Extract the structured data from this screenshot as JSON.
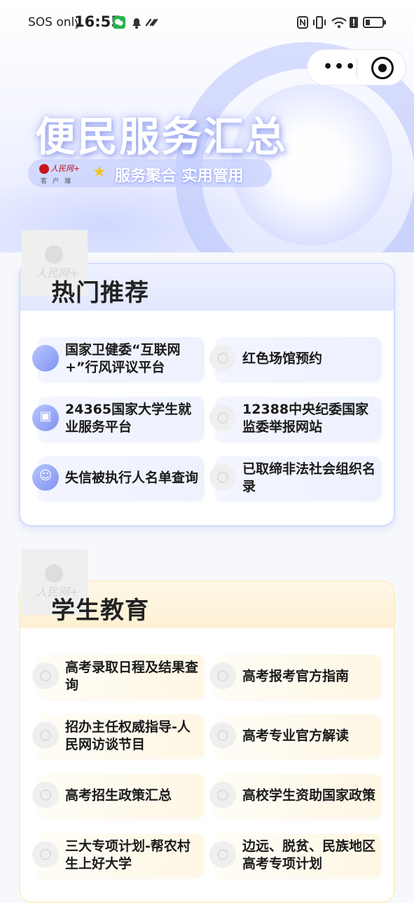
{
  "status_bar": {
    "carrier": "SOS only",
    "time": "16:55"
  },
  "header": {
    "title": "便民服务汇总",
    "logo_brand": "人民网+",
    "logo_sub": "客户端",
    "tagline": "服务聚合 实用管用"
  },
  "capsule": {
    "more_label": "•••"
  },
  "hot": {
    "title": "热门推荐",
    "watermark": "人民网+",
    "items": [
      {
        "label": "国家卫健委“互联网+”行风评议平台"
      },
      {
        "label": "红色场馆预约"
      },
      {
        "label": "24365国家大学生就业服务平台"
      },
      {
        "label": "12388中央纪委国家监委举报网站"
      },
      {
        "label": "失信被执行人名单查询"
      },
      {
        "label": "已取缔非法社会组织名录"
      }
    ]
  },
  "edu": {
    "title": "学生教育",
    "watermark": "人民网+",
    "items": [
      {
        "label": "高考录取日程及结果查询"
      },
      {
        "label": "高考报考官方指南"
      },
      {
        "label": "招办主任权威指导-人民网访谈节目"
      },
      {
        "label": "高考专业官方解读"
      },
      {
        "label": "高考招生政策汇总"
      },
      {
        "label": "高校学生资助国家政策"
      },
      {
        "label": "三大专项计划-帮农村生上好大学"
      },
      {
        "label": "边远、脱贫、民族地区高考专项计划"
      }
    ]
  },
  "colors": {
    "hot_border": "#d3dbff",
    "edu_border": "#fdeec8",
    "accent_blue": "#7f93f0"
  }
}
